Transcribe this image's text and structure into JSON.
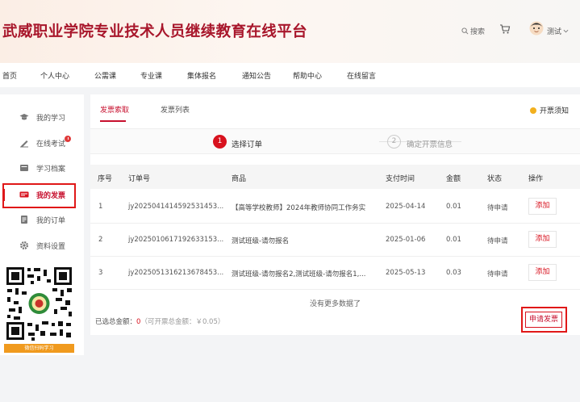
{
  "header": {
    "site_title": "武威职业学院专业技术人员继续教育在线平台",
    "search_label": "搜索",
    "user_name": "测试"
  },
  "main_nav": [
    "首页",
    "个人中心",
    "公需课",
    "专业课",
    "集体报名",
    "通知公告",
    "帮助中心",
    "在线留言"
  ],
  "sidebar": {
    "items": [
      {
        "label": "我的学习",
        "icon": "graduation-cap-icon"
      },
      {
        "label": "在线考试",
        "icon": "exam-icon",
        "badge": true
      },
      {
        "label": "学习档案",
        "icon": "archive-icon"
      },
      {
        "label": "我的发票",
        "icon": "invoice-icon",
        "active": true
      },
      {
        "label": "我的订单",
        "icon": "order-icon"
      },
      {
        "label": "资料设置",
        "icon": "gear-icon"
      }
    ],
    "qr_caption": "微信扫码学习"
  },
  "tabs": [
    "发票索取",
    "发票列表"
  ],
  "notice": "开票须知",
  "steps": [
    {
      "num": "1",
      "label": "选择订单"
    },
    {
      "num": "2",
      "label": "确定开票信息"
    }
  ],
  "table": {
    "headers": [
      "序号",
      "订单号",
      "商品",
      "支付时间",
      "金额",
      "状态",
      "操作"
    ],
    "rows": [
      {
        "idx": "1",
        "order": "jy2025041414592531453...",
        "goods": "【高等学校教师】2024年教师协同工作务实",
        "time": "2025-04-14",
        "amount": "0.01",
        "status": "待申请",
        "action": "添加"
      },
      {
        "idx": "2",
        "order": "jy2025010617192633153...",
        "goods": "测试班级-请勿报名",
        "time": "2025-01-06",
        "amount": "0.01",
        "status": "待申请",
        "action": "添加"
      },
      {
        "idx": "3",
        "order": "jy2025051316213678453...",
        "goods": "测试班级-请勿报名2,测试班级-请勿报名1,...",
        "time": "2025-05-13",
        "amount": "0.03",
        "status": "待申请",
        "action": "添加"
      }
    ],
    "no_more": "没有更多数据了"
  },
  "summary": {
    "label": "已选总金额：",
    "amount": "0",
    "sub": "（可开票总金额：￥0.05）"
  },
  "apply_button": "申请发票",
  "colors": {
    "brand": "#c7102e",
    "accent": "#f2b01e",
    "highlight": "#e01818"
  }
}
